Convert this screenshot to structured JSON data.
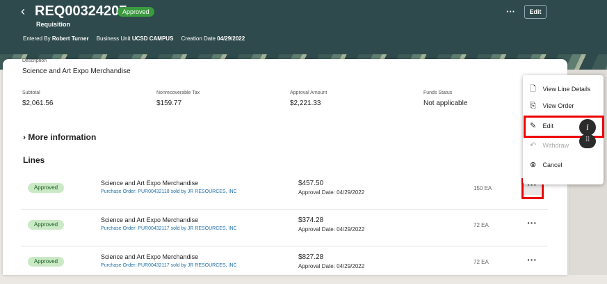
{
  "header": {
    "back_glyph": "‹",
    "title": "REQ00324207",
    "status_badge": "Approved",
    "subtitle": "Requisition",
    "entered_by_label": "Entered By",
    "entered_by": "Robert Turner",
    "business_unit_label": "Business Unit",
    "business_unit": "UCSD CAMPUS",
    "creation_date_label": "Creation Date",
    "creation_date": "04/29/2022",
    "more_glyph": "···",
    "edit_label": "Edit"
  },
  "summary": {
    "description_label": "Description",
    "description": "Science and Art Expo Merchandise",
    "subtotal_label": "Subtotal",
    "subtotal": "$2,061.56",
    "tax_label": "Nonrecoverable Tax",
    "tax": "$159.77",
    "approval_amount_label": "Approval Amount",
    "approval_amount": "$2,221.33",
    "funds_status_label": "Funds Status",
    "funds_status": "Not applicable"
  },
  "more_info": "More information",
  "more_info_chevron": "›",
  "lines_title": "Lines",
  "lines": [
    {
      "status": "Approved",
      "name": "Science and Art Expo Merchandise",
      "po": "Purchase Order: PUR00432118 sold by JR RESOURCES, INC",
      "amount": "$457.50",
      "approval_date": "Approval Date: 04/29/2022",
      "qty": "150 EA",
      "more": "···"
    },
    {
      "status": "Approved",
      "name": "Science and Art Expo Merchandise",
      "po": "Purchase Order: PUR00432117 sold by JR RESOURCES, INC",
      "amount": "$374.28",
      "approval_date": "Approval Date: 04/29/2022",
      "qty": "72 EA",
      "more": "···"
    },
    {
      "status": "Approved",
      "name": "Science and Art Expo Merchandise",
      "po": "Purchase Order: PUR00432117 sold by JR RESOURCES, INC",
      "amount": "$827.28",
      "approval_date": "Approval Date: 04/29/2022",
      "qty": "72 EA",
      "more": "···"
    }
  ],
  "menu": {
    "items": [
      {
        "label": "View Line Details",
        "icon": "document-search-icon",
        "glyph": "🗋"
      },
      {
        "label": "View Order",
        "icon": "order-icon",
        "glyph": "⎘"
      },
      {
        "label": "Edit",
        "icon": "pencil-icon",
        "glyph": "✎"
      },
      {
        "label": "Withdraw",
        "icon": "undo-icon",
        "glyph": "↶"
      },
      {
        "label": "Cancel",
        "icon": "cancel-circle-icon",
        "glyph": "⊗"
      }
    ]
  },
  "fabs": {
    "info_glyph": "i",
    "grid_glyph": "⠿"
  },
  "colors": {
    "header_bg": "#2f4a4c",
    "approved_badge": "#3a9a3e",
    "pill_bg": "#cbe9c7",
    "link": "#1f6fa8",
    "highlight": "#e00000"
  }
}
